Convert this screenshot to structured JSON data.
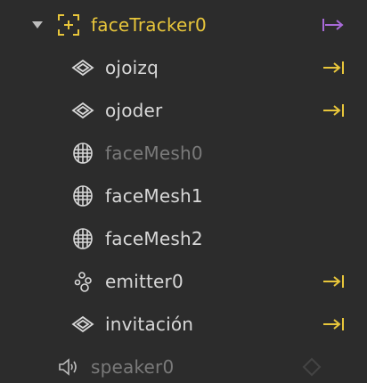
{
  "tree": {
    "root": {
      "label": "faceTracker0",
      "icon": "face-tracker-icon",
      "expanded": true,
      "action_icon": "bind-to-patch-arrow-icon",
      "accent": "#e8c63b",
      "action_color": "#a86ad8"
    },
    "children": [
      {
        "label": "ojoizq",
        "icon": "plane-icon",
        "action_icon": "arrow-to-bar-icon",
        "disabled": false
      },
      {
        "label": "ojoder",
        "icon": "plane-icon",
        "action_icon": "arrow-to-bar-icon",
        "disabled": false
      },
      {
        "label": "faceMesh0",
        "icon": "face-mesh-icon",
        "action_icon": "",
        "disabled": true
      },
      {
        "label": "faceMesh1",
        "icon": "face-mesh-icon",
        "action_icon": "",
        "disabled": false
      },
      {
        "label": "faceMesh2",
        "icon": "face-mesh-icon",
        "action_icon": "",
        "disabled": false
      },
      {
        "label": "emitter0",
        "icon": "emitter-icon",
        "action_icon": "arrow-to-bar-icon",
        "disabled": false
      },
      {
        "label": "invitación",
        "icon": "plane-icon",
        "action_icon": "arrow-to-bar-icon",
        "disabled": false
      }
    ],
    "sibling": {
      "label": "speaker0",
      "icon": "speaker-icon",
      "disabled": true,
      "trailing_icon": "diamond-icon"
    }
  },
  "colors": {
    "background": "#2c2c2c",
    "text": "#d8d8d8",
    "text_disabled": "#7a7a7a",
    "yellow_accent": "#e8c63b",
    "purple_accent": "#a86ad8"
  }
}
